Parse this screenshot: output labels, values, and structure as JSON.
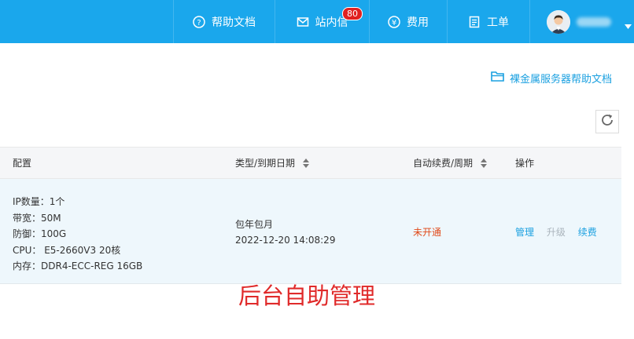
{
  "nav": {
    "help": "帮助文档",
    "messages": "站内信",
    "messages_badge": "80",
    "fees": "费用",
    "tickets": "工单"
  },
  "doc_link": "裸金属服务器帮助文档",
  "table": {
    "headers": {
      "config": "配置",
      "type_expiry": "类型/到期日期",
      "auto_renew": "自动续费/周期",
      "actions": "操作"
    },
    "rows": [
      {
        "spec": [
          "IP数量：1个",
          "带宽：50M",
          "防御：100G",
          "CPU： E5-2660V3 20核",
          "内存：DDR4-ECC-REG 16GB"
        ],
        "type": "包年包月",
        "expiry": "2022-12-20 14:08:29",
        "auto_renew": "未开通",
        "actions": {
          "manage": "管理",
          "upgrade": "升级",
          "renew": "续费"
        }
      }
    ]
  },
  "caption": "后台自助管理",
  "colors": {
    "topbar": "#1aa7ec",
    "link": "#1aa0e0",
    "warning": "#e04a1a",
    "caption": "#e02a2a",
    "badge": "#e02020"
  },
  "icons": [
    "question-circle-icon",
    "mail-icon",
    "yen-circle-icon",
    "document-icon",
    "folder-icon",
    "refresh-icon",
    "chevron-down-icon"
  ]
}
